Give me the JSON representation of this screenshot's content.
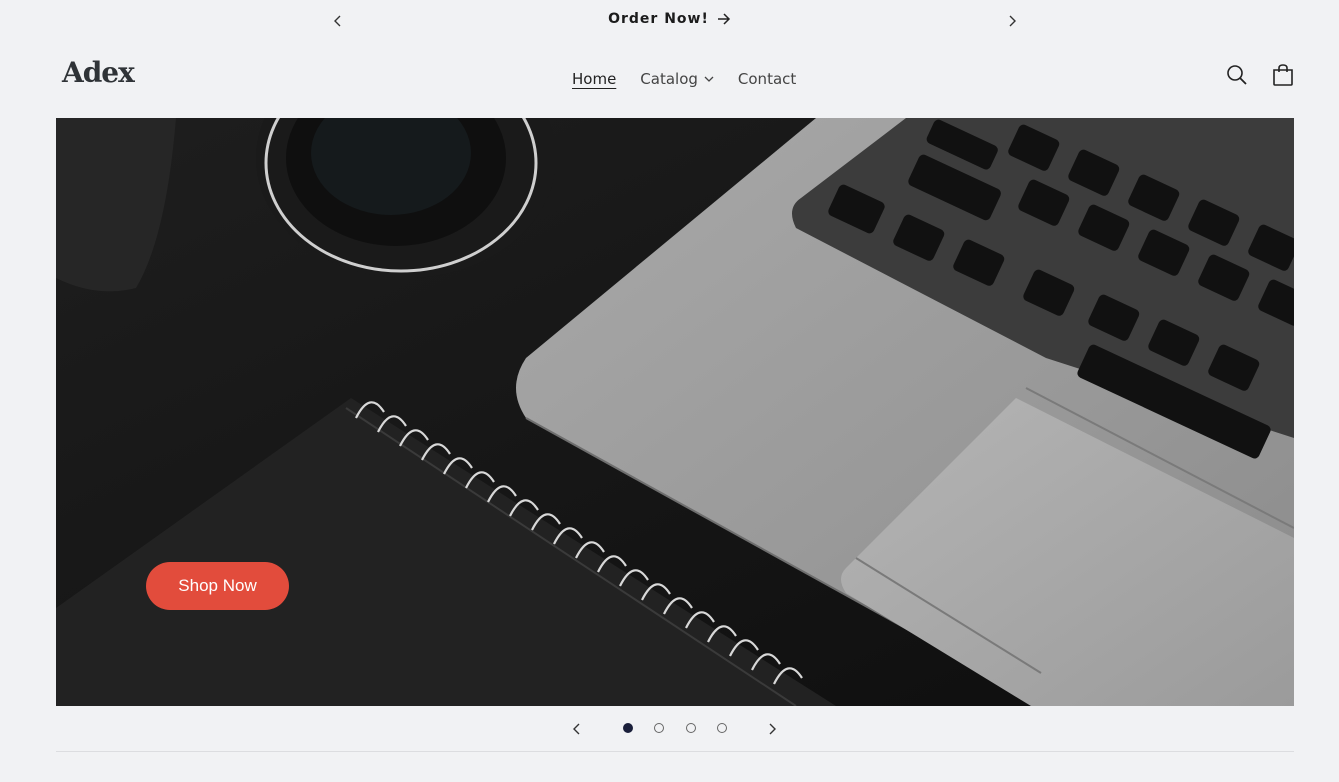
{
  "announcement": {
    "text": "Order Now!",
    "prev_icon": "chevron-left-icon",
    "next_icon": "chevron-right-icon",
    "arrow_icon": "arrow-right-icon"
  },
  "header": {
    "logo": "Adex",
    "nav": [
      {
        "label": "Home",
        "active": true
      },
      {
        "label": "Catalog",
        "has_dropdown": true
      },
      {
        "label": "Contact"
      }
    ],
    "icons": [
      "search-icon",
      "cart-icon"
    ]
  },
  "hero": {
    "cta_label": "Shop Now",
    "colors": {
      "cta": "#e24c3c"
    }
  },
  "slider": {
    "slide_count": 4,
    "active_index": 0,
    "prev_icon": "chevron-left-icon",
    "next_icon": "chevron-right-icon"
  }
}
